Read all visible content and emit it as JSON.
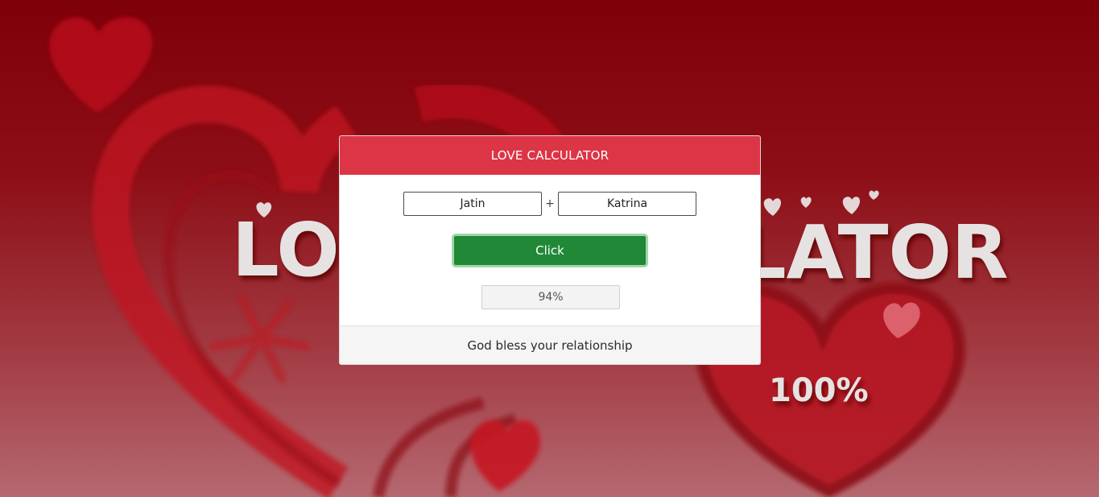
{
  "background": {
    "title_left": "LO",
    "title_right": "LATOR",
    "percent": "100%",
    "base_color": "#8a0a12"
  },
  "card": {
    "title": "LOVE CALCULATOR",
    "header_color": "#dc3545",
    "name1": "Jatin",
    "plus": "+",
    "name2": "Katrina",
    "button_label": "Click",
    "button_color": "#218838",
    "result": "94%",
    "footer_message": "God bless your relationship"
  }
}
